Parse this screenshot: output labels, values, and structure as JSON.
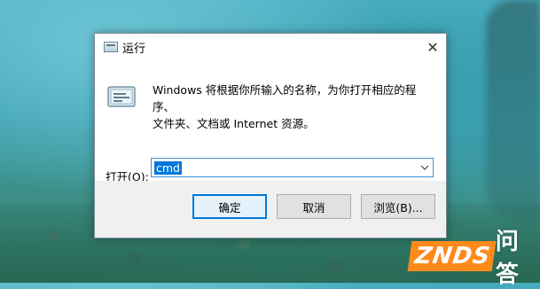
{
  "dialog": {
    "title": "运行",
    "close_glyph": "✕",
    "description_line1": "Windows 将根据你所输入的名称，为你打开相应的程序、",
    "description_line2": "文件夹、文档或 Internet 资源。",
    "open_label_pre": "打开(",
    "open_label_accel": "O",
    "open_label_post": "):",
    "open_value": "cmd",
    "buttons": {
      "ok": "确定",
      "cancel": "取消",
      "browse": "浏览(B)..."
    },
    "accent_color": "#0078d7",
    "icons": {
      "title": "run-dialog-icon",
      "large": "run-app-icon",
      "dropdown": "chevron-down-icon"
    }
  },
  "watermark": {
    "brand": "ZNDS",
    "suffix": "问答"
  }
}
